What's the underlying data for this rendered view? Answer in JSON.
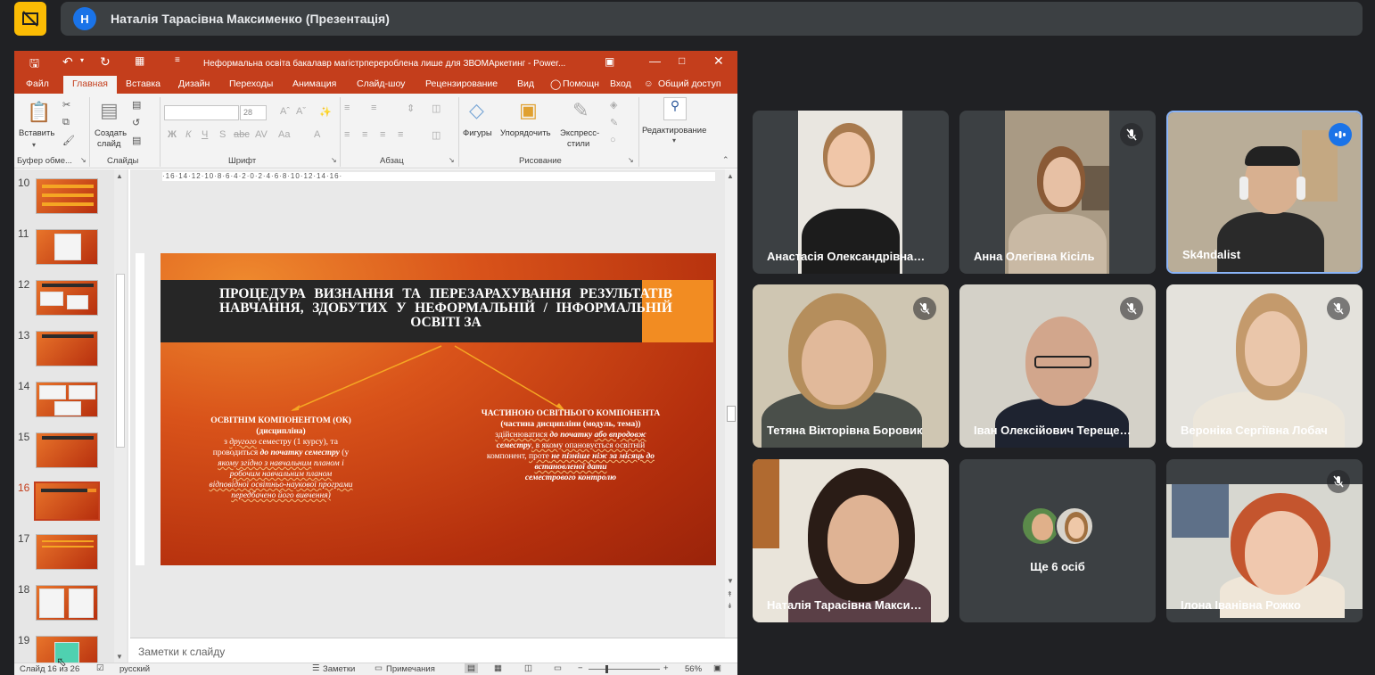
{
  "meet": {
    "presenter_initial": "Н",
    "presenter_title": "Наталія Тарасівна Максименко (Презентація)",
    "more_people": "Ще 6 осіб",
    "participants": [
      {
        "name": "Анастасія Олександрівна…",
        "muted": false
      },
      {
        "name": "Анна Олегівна Кісіль",
        "muted": true
      },
      {
        "name": "Sk4ndalist",
        "muted": false,
        "speaking": true
      },
      {
        "name": "Тетяна Вікторівна Боровик",
        "muted": true
      },
      {
        "name": "Іван Олексійович Терещe…",
        "muted": true
      },
      {
        "name": "Вероніка Сергіївна Лобач",
        "muted": true
      },
      {
        "name": "Наталія Тарасівна Макси…",
        "muted": false
      },
      {
        "name": "Ілона Іванівна Рожко",
        "muted": true
      }
    ]
  },
  "ppt": {
    "window_title": "Неформальна освіта бакалавр магістрперероблена лише для ЗВОМАркетинг - Power...",
    "tabs": [
      "Файл",
      "Главная",
      "Вставка",
      "Дизайн",
      "Переходы",
      "Анимация",
      "Слайд-шоу",
      "Рецензирование",
      "Вид"
    ],
    "help": "Помощн",
    "signin": "Вход",
    "share": "Общий доступ",
    "ribbon": {
      "paste": "Вставить",
      "create_slide_1": "Создать",
      "create_slide_2": "слайд",
      "font_size": "28",
      "shapes": "Фигуры",
      "arrange": "Упорядочить",
      "express_1": "Экспресс-",
      "express_2": "стили",
      "editing": "Редактирование",
      "groups": {
        "clipboard": "Буфер обме...",
        "slides": "Слайды",
        "font": "Шрифт",
        "paragraph": "Абзац",
        "drawing": "Рисование"
      }
    },
    "thumbnail_numbers": [
      "10",
      "11",
      "12",
      "13",
      "14",
      "15",
      "16",
      "17",
      "18",
      "19"
    ],
    "selected_slide": "16",
    "ruler_text": "·16·14·12·10·8·6·4·2·0·2·4·6·8·10·12·14·16·",
    "slide": {
      "title": "ПРОЦЕДУРА ВИЗНАННЯ ТА ПЕРЕЗАРАХУВАННЯ РЕЗУЛЬТАТІВ НАВЧАННЯ, ЗДОБУТИХ У НЕФОРМАЛЬНІЙ / ІНФОРМАЛЬНІЙ ОСВІТІ ЗА",
      "left_heading": "ОСВІТНІМ КОМПОНЕНТОМ (ОК)",
      "left_sub": "(дисципліна)",
      "left_l1a": "з ",
      "left_l1b": "другого",
      "left_l1c": " семестру (1 курсу), та",
      "left_l2a": "проводиться ",
      "left_l2b": "до початку семестру",
      "left_l2c": " (у",
      "left_l3a": "якому згідно з навчальним",
      "left_l3b": " планом і",
      "left_l4": "робочим навчальним планом",
      "left_l5": "відповідної освітньо-наукової програми",
      "left_l6": "передбачено його вивчення)",
      "right_heading": "ЧАСТИНОЮ ОСВІТНЬОГО КОМПОНЕНТА",
      "right_sub": "(частина дисципліни (модуль, тема))",
      "right_l1a": "здійснюватися ",
      "right_l1b": "до початку",
      "right_l1c": " ",
      "right_l1d": "або впродовж",
      "right_l2a": "семестру",
      "right_l2b": ", в якому опановується освітній",
      "right_l3a": "компонент, ",
      "right_l3b": "проте",
      "right_l3c": " не пізніше ніж за місяць до",
      "right_l4": "встановленої дати",
      "right_l5": "семестрового контролю"
    },
    "notes_placeholder": "Заметки к слайду",
    "status": {
      "slide_of": "Слайд 16 из 26",
      "language": "русский",
      "notes": "Заметки",
      "comments": "Примечания",
      "zoom": "56%"
    }
  },
  "colors": {
    "meet_bg": "#202124",
    "tile_bg": "#3c4043",
    "ppt_accent": "#c43e1c",
    "speaking": "#1a73e8",
    "top_icon": "#fbbc04"
  }
}
